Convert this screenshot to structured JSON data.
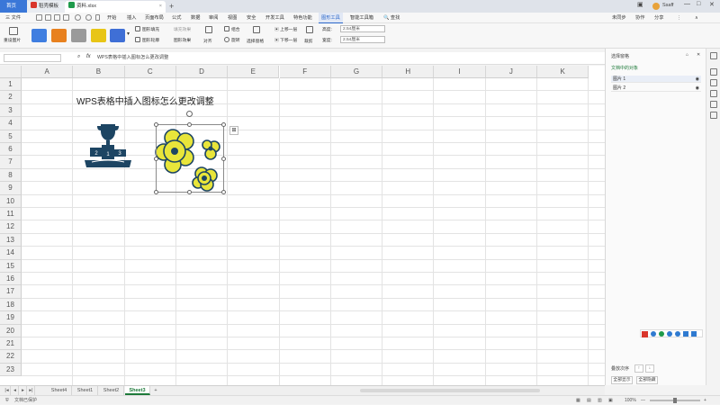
{
  "tabs": {
    "home": "首页",
    "wps": "稻壳模板",
    "file": "资料.xlsx",
    "add": "+"
  },
  "window": {
    "user": "Ssaff",
    "minimize": "—",
    "maximize": "□",
    "close": "✕"
  },
  "menu": {
    "file_label": "三 文件",
    "items": [
      "开始",
      "插入",
      "页面布局",
      "公式",
      "数据",
      "审阅",
      "视图",
      "安全",
      "开发工具",
      "特色功能",
      "图形工具",
      "智能工具箱"
    ],
    "active": "图形工具",
    "search": "查找",
    "right_items": [
      "未同步",
      "协作",
      "分享"
    ]
  },
  "ribbon": {
    "reset_label": "重设图片",
    "swatch_colors": [
      "#3f7ee0",
      "#e8811f",
      "#9a9a9a",
      "#e8c516",
      "#3f6fd6"
    ],
    "fill_label": "图形填充",
    "fill_fx": "填充效果",
    "outline_label": "图形轮廓",
    "effect_label": "图形效果",
    "align_label": "对齐",
    "group_label": "组合",
    "rotate_label": "旋转",
    "select_label": "选择窗格",
    "up_label": "上移一层",
    "down_label": "下移一层",
    "size_label": "裁剪",
    "height_label": "高度:",
    "height_value": "2.54厘米",
    "width_label": "宽度:",
    "width_value": "2.54厘米"
  },
  "formula": {
    "fx": "fx",
    "content": "WPS表格中插入图标怎么更改调整"
  },
  "grid": {
    "columns": [
      "A",
      "B",
      "C",
      "D",
      "E",
      "F",
      "G",
      "H",
      "I",
      "J",
      "K"
    ],
    "rows": [
      "1",
      "2",
      "3",
      "4",
      "5",
      "6",
      "7",
      "8",
      "9",
      "10",
      "11",
      "12",
      "13",
      "14",
      "15",
      "16",
      "17",
      "18",
      "19",
      "20",
      "21",
      "22",
      "23"
    ],
    "title_cell": "WPS表格中插入图标怎么更改调整",
    "trophy_color": "#1d4563",
    "flower_color": "#e8e53a",
    "flower_outline": "#1d4563"
  },
  "taskpane": {
    "title": "选择窗格",
    "section": "文档中的对象",
    "objects": [
      "图片 1",
      "图片 2"
    ],
    "order_label": "叠放次序",
    "show_all": "全部显示",
    "hide_all": "全部隐藏"
  },
  "sheets": {
    "tabs": [
      "Sheet4",
      "Sheet1",
      "Sheet2",
      "Sheet3"
    ],
    "active": "Sheet3",
    "add": "+"
  },
  "status": {
    "left": "文档已保护",
    "zoom": "100%"
  }
}
